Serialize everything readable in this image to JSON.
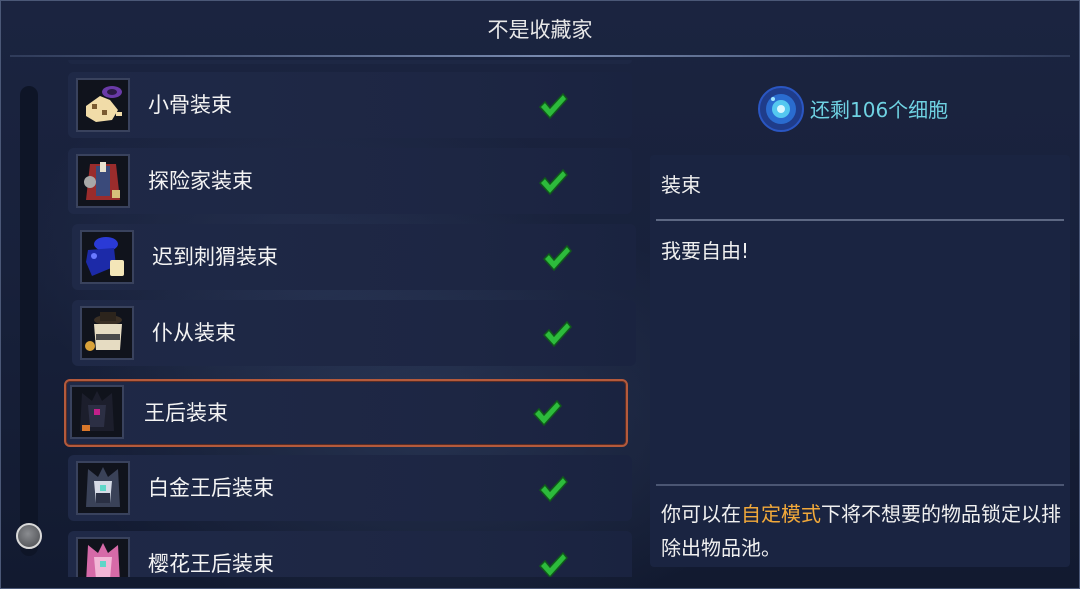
{
  "window": {
    "title": "不是收藏家"
  },
  "items": [
    {
      "label": "小骨装束",
      "icon": "skull-hand-outfit-icon",
      "checked": true,
      "selected": false
    },
    {
      "label": "探险家装束",
      "icon": "explorer-outfit-icon",
      "checked": true,
      "selected": false
    },
    {
      "label": "迟到刺猬装束",
      "icon": "late-hedgehog-outfit-icon",
      "checked": true,
      "selected": false
    },
    {
      "label": "仆从装束",
      "icon": "servant-outfit-icon",
      "checked": true,
      "selected": false
    },
    {
      "label": "王后装束",
      "icon": "queen-outfit-icon",
      "checked": true,
      "selected": true
    },
    {
      "label": "白金王后装束",
      "icon": "platinum-queen-outfit-icon",
      "checked": true,
      "selected": false
    },
    {
      "label": "樱花王后装束",
      "icon": "sakura-queen-outfit-icon",
      "checked": true,
      "selected": false
    }
  ],
  "cells": {
    "text": "还剩106个细胞",
    "icon": "cell-orb-icon"
  },
  "detail": {
    "category": "装束",
    "description": "我要自由!",
    "hint_before": "你可以在",
    "hint_highlight": "自定模式",
    "hint_after": "下将不想要的物品锁定以排除出物品池。"
  },
  "colors": {
    "accent_cyan": "#6fd2e2",
    "highlight_orange": "#f2a93a",
    "selected_border": "#b45a3c",
    "check_green": "#2dbb3c"
  }
}
